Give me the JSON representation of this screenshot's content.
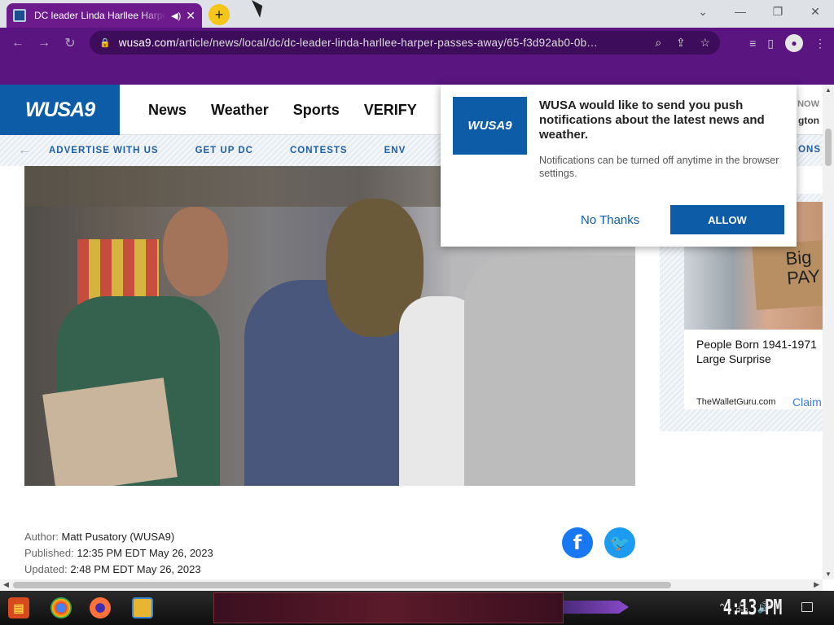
{
  "browser": {
    "tab_title": "DC leader Linda Harllee Harper passes away",
    "url_domain": "wusa9.com",
    "url_path": "/article/news/local/dc/dc-leader-linda-harllee-harper-passes-away/65-f3d92ab0-0b…"
  },
  "site": {
    "logo": "WUSA9",
    "nav": [
      "News",
      "Weather",
      "Sports",
      "VERIFY"
    ],
    "header_right_top": "NOW",
    "header_right_bottom": "gton",
    "subnav": [
      "ADVERTISE WITH US",
      "GET UP DC",
      "CONTESTS",
      "ENV"
    ],
    "subnav_tail": "ONS"
  },
  "popup": {
    "logo": "WUSA9",
    "title": "WUSA would like to send you push notifications about the latest news and weather.",
    "description": "Notifications can be turned off anytime in the browser settings.",
    "no_thanks": "No Thanks",
    "allow": "ALLOW"
  },
  "article": {
    "author_label": "Author:",
    "author": "Matt Pusatory (WUSA9)",
    "published_label": "Published:",
    "published": "12:35 PM EDT May 26, 2023",
    "updated_label": "Updated:",
    "updated": "2:48 PM EDT May 26, 2023"
  },
  "ad": {
    "sign_text": "Big PAY",
    "headline_line1": "People Born 1941-1971",
    "headline_line2": "Large Surprise",
    "source": "TheWalletGuru.com",
    "cta": "Claim"
  },
  "taskbar": {
    "clock": "4:13 PM"
  },
  "icons": {
    "lock": "lock-icon",
    "search": "search-icon",
    "share": "share-icon",
    "star": "star-icon",
    "facebook": "facebook-icon",
    "twitter": "twitter-icon"
  },
  "colors": {
    "browser_purple": "#5a1580",
    "wusa_blue": "#0c5ca8",
    "facebook": "#1877f2",
    "twitter": "#1d9bf0"
  }
}
